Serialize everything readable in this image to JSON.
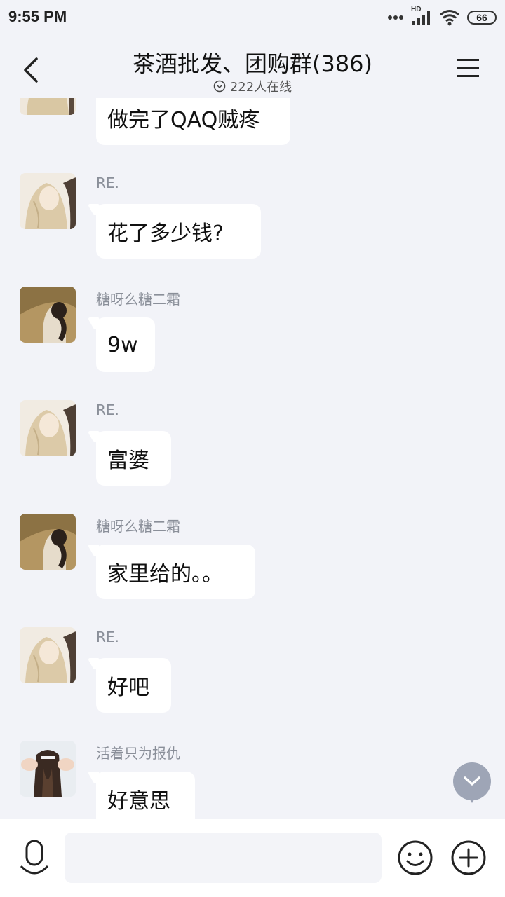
{
  "status_bar": {
    "time": "9:55 PM",
    "network": "HD",
    "battery": "66"
  },
  "header": {
    "title": "茶酒批发、团购群(386)",
    "online": "222人在线"
  },
  "messages": [
    {
      "sender": "",
      "text": "做完了QAQ贼疼",
      "avatar": "avatar-blonde-girl"
    },
    {
      "sender": "RE.",
      "text": "花了多少钱?",
      "avatar": "avatar-blonde-girl"
    },
    {
      "sender": "糖呀么糖二霜",
      "text": "9w",
      "avatar": "avatar-dark-hair-girl"
    },
    {
      "sender": "RE.",
      "text": "富婆",
      "avatar": "avatar-blonde-girl"
    },
    {
      "sender": "糖呀么糖二霜",
      "text": "家里给的。。",
      "avatar": "avatar-dark-hair-girl"
    },
    {
      "sender": "RE.",
      "text": "好吧",
      "avatar": "avatar-blonde-girl"
    },
    {
      "sender": "活着只为报仇",
      "text": "好意思",
      "avatar": "avatar-ponytail-girl"
    }
  ],
  "input": {
    "placeholder": "",
    "value": ""
  },
  "colors": {
    "background": "#f2f3f8",
    "bubble": "#ffffff",
    "sender_name": "#8a8f99",
    "scroll_button": "#9ea5b6"
  }
}
